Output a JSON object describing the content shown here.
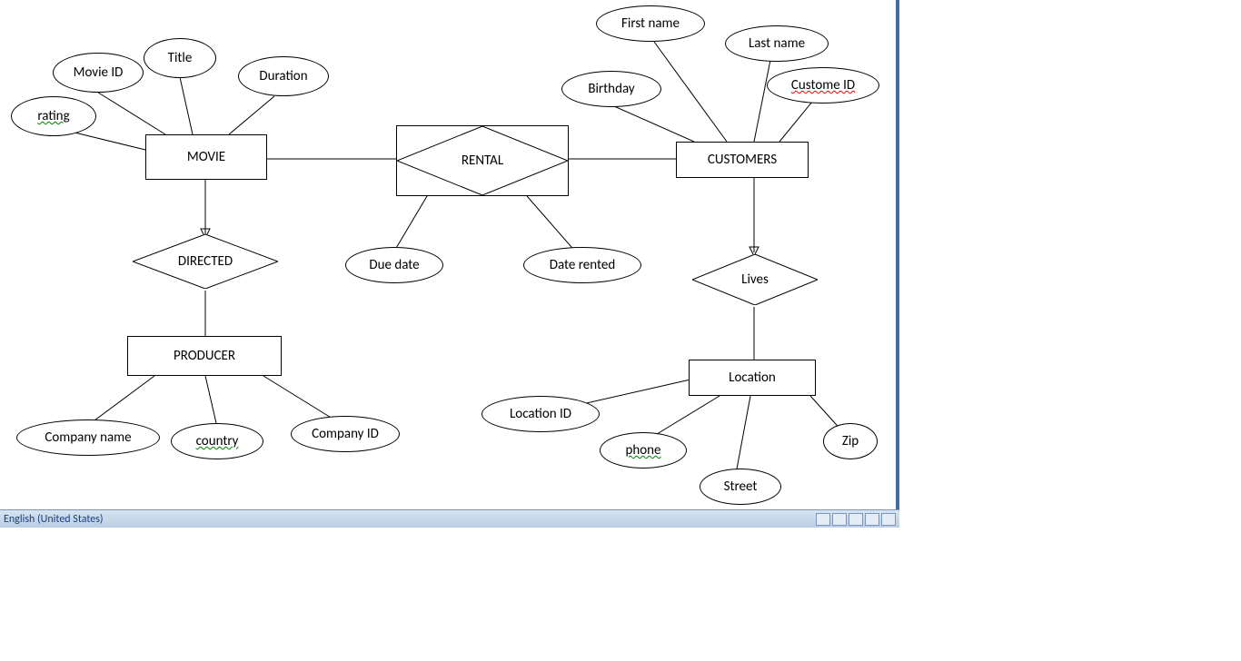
{
  "statusbar": {
    "language": "English (United States)"
  },
  "entities": {
    "movie": {
      "label": "MOVIE"
    },
    "customers": {
      "label": "CUSTOMERS"
    },
    "producer": {
      "label": "PRODUCER"
    },
    "location": {
      "label": "Location"
    }
  },
  "relationships": {
    "rental": {
      "label": "RENTAL"
    },
    "directed": {
      "label": "DIRECTED"
    },
    "lives": {
      "label": "Lives"
    }
  },
  "attributes": {
    "movie_id": {
      "label": "Movie ID"
    },
    "title": {
      "label": "Title"
    },
    "duration": {
      "label": "Duration"
    },
    "rating": {
      "label": "rating"
    },
    "due_date": {
      "label": "Due date"
    },
    "date_rented": {
      "label": "Date rented"
    },
    "first_name": {
      "label": "First name"
    },
    "last_name": {
      "label": "Last name"
    },
    "birthday": {
      "label": "Birthday"
    },
    "custome_id": {
      "label": "Custome ID"
    },
    "company_name": {
      "label": "Company name"
    },
    "country": {
      "label": "country"
    },
    "company_id": {
      "label": "Company ID"
    },
    "location_id": {
      "label": "Location ID"
    },
    "phone": {
      "label": "phone"
    },
    "street": {
      "label": "Street"
    },
    "zip": {
      "label": "Zip"
    }
  }
}
